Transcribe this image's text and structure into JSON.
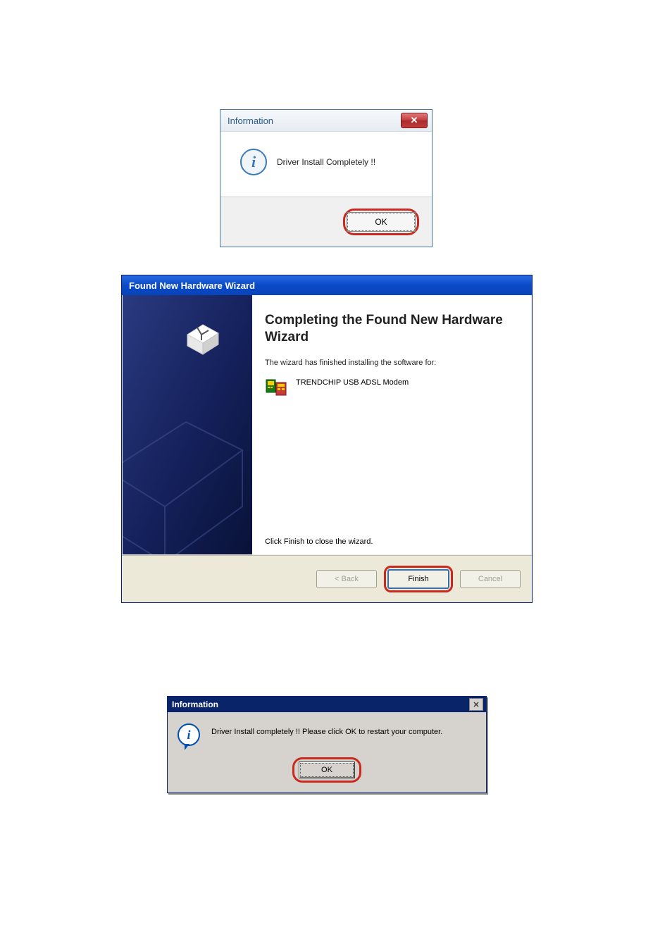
{
  "dialog1": {
    "title": "Information",
    "close_glyph": "✕",
    "message": "Driver Install Completely !!",
    "ok_label": "OK"
  },
  "dialog2": {
    "title": "Found New Hardware Wizard",
    "heading_line": "Completing the Found New Hardware Wizard",
    "sub_text": "The wizard has finished installing the software for:",
    "device_name": "TRENDCHIP USB ADSL Modem",
    "close_instruction": "Click Finish to close the wizard.",
    "back_label": "< Back",
    "finish_label": "Finish",
    "cancel_label": "Cancel"
  },
  "dialog3": {
    "title": "Information",
    "close_glyph": "✕",
    "message": "Driver Install completely !! Please click OK to restart your computer.",
    "ok_label": "OK"
  }
}
